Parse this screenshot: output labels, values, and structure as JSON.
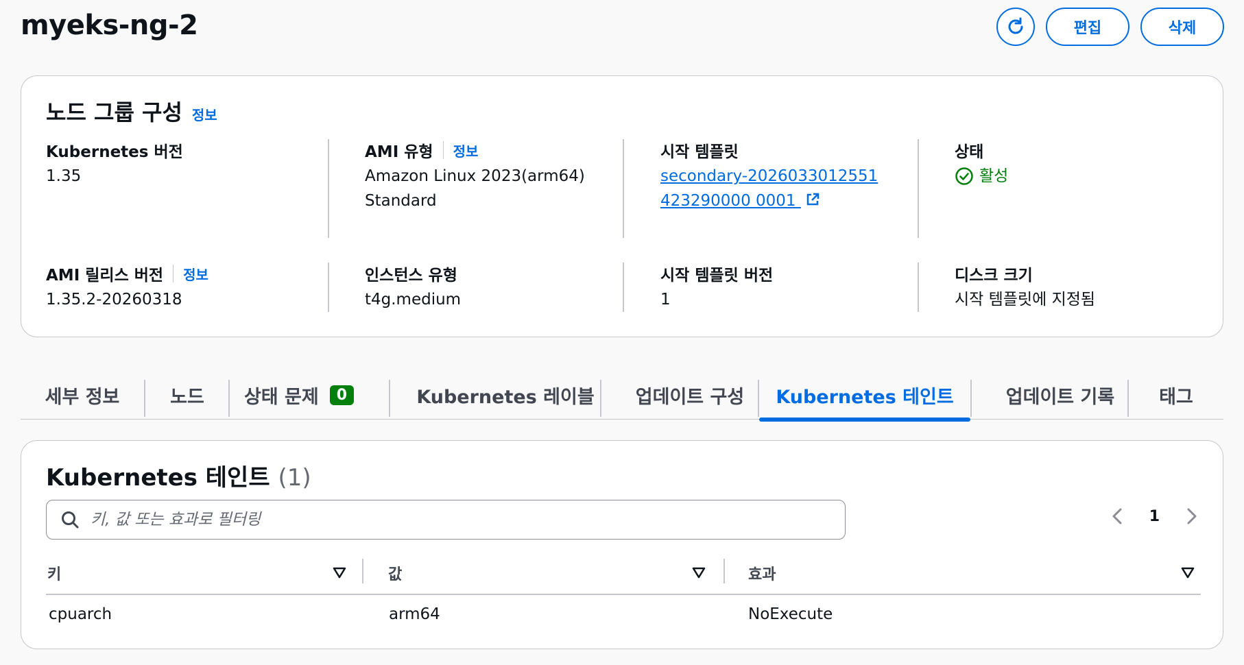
{
  "header": {
    "title": "myeks-ng-2",
    "edit_label": "편집",
    "delete_label": "삭제",
    "refresh_icon": "refresh-icon"
  },
  "config": {
    "title": "노드 그룹 구성",
    "info": "정보",
    "k8s_version_label": "Kubernetes 버전",
    "k8s_version_value": "1.35",
    "ami_type_label": "AMI 유형",
    "ami_type_info": "정보",
    "ami_type_value_line1": "Amazon Linux 2023(arm64)",
    "ami_type_value_line2": "Standard",
    "launch_template_label": "시작 템플릿",
    "launch_template_value": "secondary-2026033012551423290000 0001",
    "status_label": "상태",
    "status_value": "활성",
    "ami_release_label": "AMI 릴리스 버전",
    "ami_release_info": "정보",
    "ami_release_value": "1.35.2-20260318",
    "instance_type_label": "인스턴스 유형",
    "instance_type_value": "t4g.medium",
    "lt_version_label": "시작 템플릿 버전",
    "lt_version_value": "1",
    "disk_size_label": "디스크 크기",
    "disk_size_value": "시작 템플릿에 지정됨"
  },
  "tabs": [
    {
      "label": "세부 정보"
    },
    {
      "label": "노드"
    },
    {
      "label": "상태 문제",
      "badge": "0"
    },
    {
      "label": "Kubernetes 레이블"
    },
    {
      "label": "업데이트 구성"
    },
    {
      "label": "Kubernetes 테인트",
      "active": true
    },
    {
      "label": "업데이트 기록"
    },
    {
      "label": "태그"
    }
  ],
  "taints": {
    "title": "Kubernetes 테인트",
    "count": "(1)",
    "search_placeholder": "키, 값 또는 효과로 필터링",
    "page": "1",
    "columns": [
      "키",
      "값",
      "효과"
    ],
    "rows": [
      {
        "key": "cpuarch",
        "value": "arm64",
        "effect": "NoExecute"
      }
    ]
  },
  "colors": {
    "accent": "#006ce0",
    "success": "#037f0c",
    "border": "#c6c6cd"
  }
}
